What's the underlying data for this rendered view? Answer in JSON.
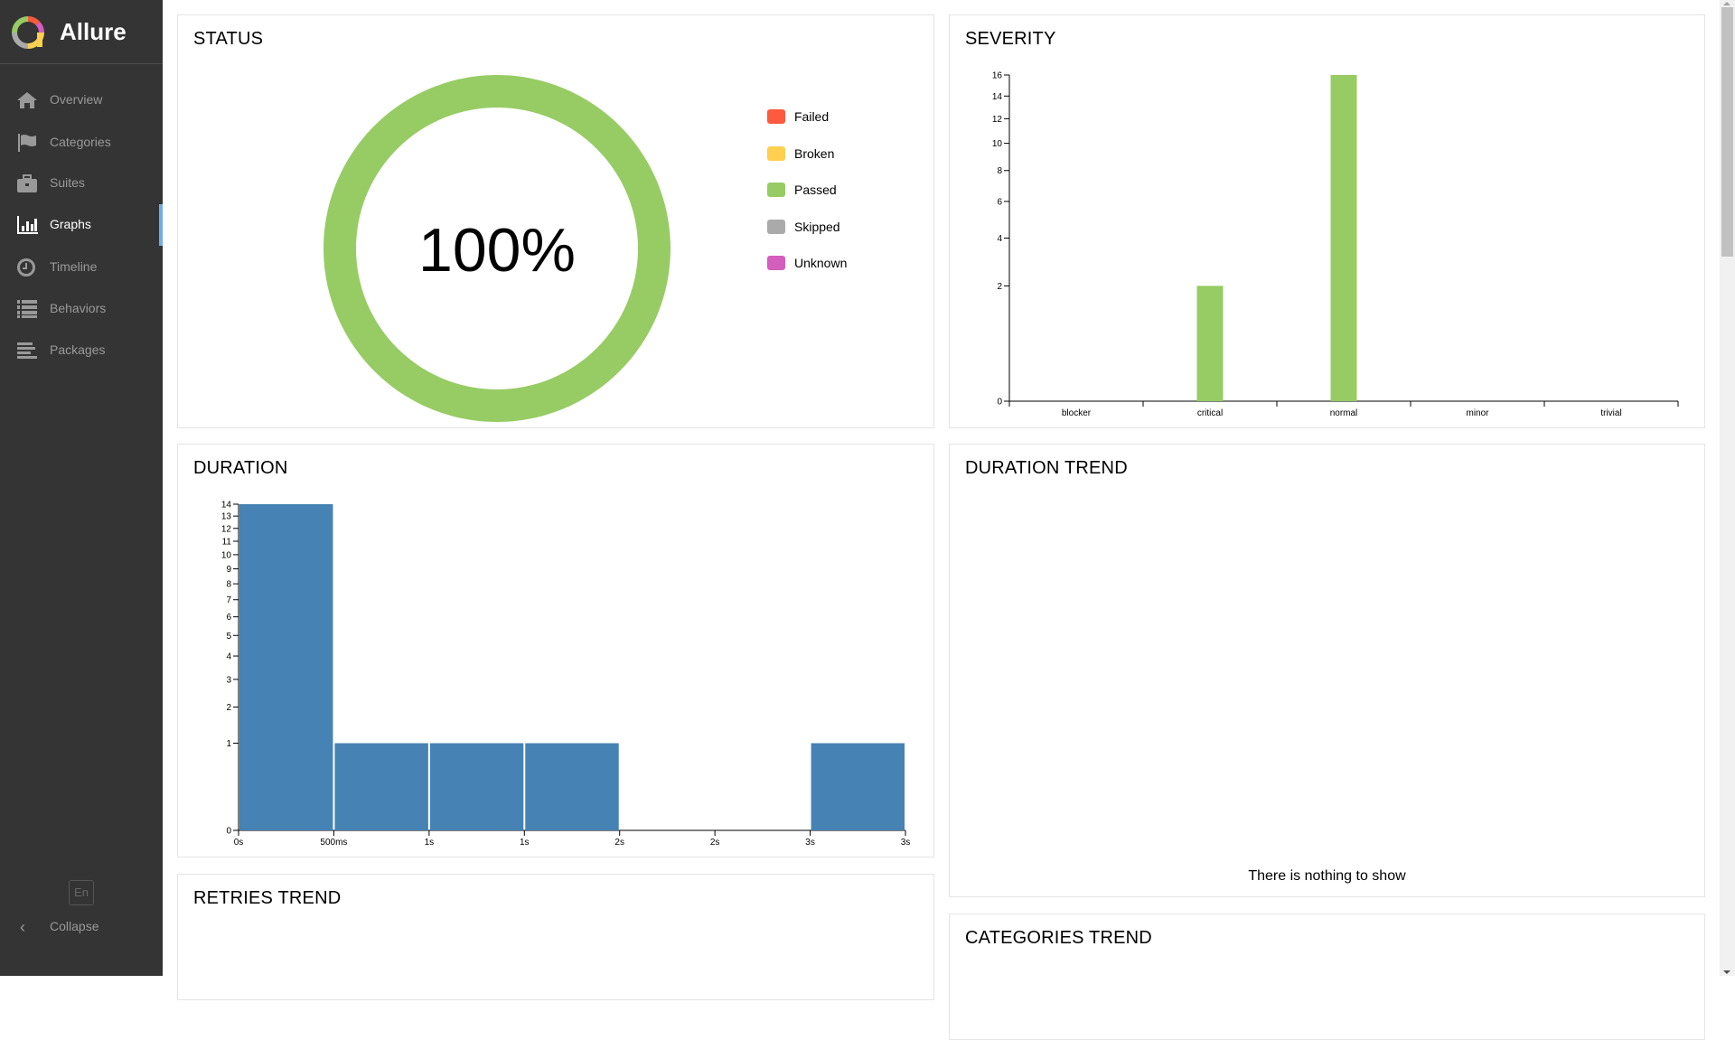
{
  "app": {
    "name": "Allure"
  },
  "sidebar": {
    "items": [
      {
        "label": "Overview",
        "icon": "home-icon",
        "active": false
      },
      {
        "label": "Categories",
        "icon": "flag-icon",
        "active": false
      },
      {
        "label": "Suites",
        "icon": "briefcase-icon",
        "active": false
      },
      {
        "label": "Graphs",
        "icon": "bar-chart-icon",
        "active": true
      },
      {
        "label": "Timeline",
        "icon": "clock-icon",
        "active": false
      },
      {
        "label": "Behaviors",
        "icon": "list-icon",
        "active": false
      },
      {
        "label": "Packages",
        "icon": "align-left-icon",
        "active": false
      }
    ],
    "language": "En",
    "collapse_label": "Collapse"
  },
  "colors": {
    "failed": "#fd5a3e",
    "broken": "#ffd050",
    "passed": "#97cc64",
    "skipped": "#aaaaaa",
    "unknown": "#d35ebe",
    "duration_bar": "#4682b4",
    "accent": "#6daee8"
  },
  "panels": {
    "status": {
      "title": "STATUS"
    },
    "severity": {
      "title": "SEVERITY"
    },
    "duration": {
      "title": "DURATION"
    },
    "duration_trend": {
      "title": "DURATION TREND",
      "empty_message": "There is nothing to show"
    },
    "retries_trend": {
      "title": "RETRIES TREND"
    },
    "categories_trend": {
      "title": "CATEGORIES TREND"
    }
  },
  "chart_data": [
    {
      "id": "status",
      "type": "pie",
      "title": "STATUS",
      "center_label": "100%",
      "slices": [
        {
          "name": "Failed",
          "value": 0
        },
        {
          "name": "Broken",
          "value": 0
        },
        {
          "name": "Passed",
          "value": 18
        },
        {
          "name": "Skipped",
          "value": 0
        },
        {
          "name": "Unknown",
          "value": 0
        }
      ],
      "legend": [
        "Failed",
        "Broken",
        "Passed",
        "Skipped",
        "Unknown"
      ],
      "legend_position": "right"
    },
    {
      "id": "severity",
      "type": "bar",
      "title": "SEVERITY",
      "categories": [
        "blocker",
        "critical",
        "normal",
        "minor",
        "trivial"
      ],
      "values": [
        0,
        2,
        16,
        0,
        0
      ],
      "yscale": "sqrt",
      "ylim": [
        0,
        16
      ],
      "yticks": [
        0,
        2,
        4,
        6,
        8,
        10,
        12,
        14,
        16
      ],
      "xlabel": "",
      "ylabel": ""
    },
    {
      "id": "duration",
      "type": "bar",
      "title": "DURATION",
      "categories": [
        "0s-500ms",
        "500ms-1s",
        "1s-1.5s",
        "1.5s-2s",
        "2s-2.5s",
        "2.5s-3s",
        "3s-3.5s"
      ],
      "values": [
        14,
        1,
        1,
        1,
        0,
        0,
        1
      ],
      "xticks": [
        "0s",
        "500ms",
        "1s",
        "1s",
        "2s",
        "2s",
        "3s",
        "3s"
      ],
      "yscale": "sqrt",
      "ylim": [
        0,
        14
      ],
      "yticks": [
        0,
        1,
        2,
        3,
        4,
        5,
        6,
        7,
        8,
        9,
        10,
        11,
        12,
        13,
        14
      ],
      "xlabel": "",
      "ylabel": ""
    }
  ]
}
